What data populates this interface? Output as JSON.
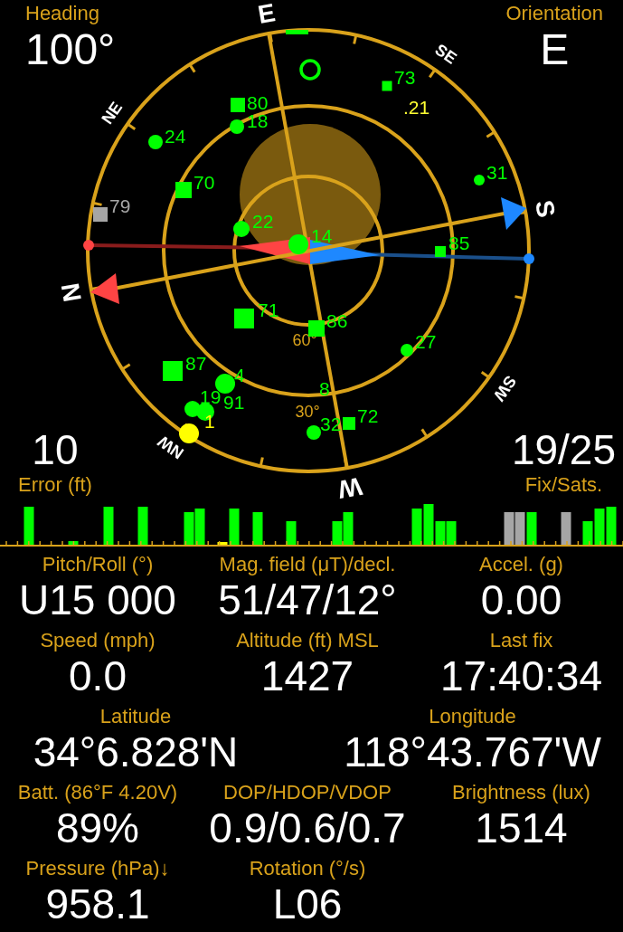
{
  "heading": {
    "label": "Heading",
    "value": "100°"
  },
  "orientation": {
    "label": "Orientation",
    "value": "E"
  },
  "compass_labels": [
    "N",
    "NE",
    "E",
    "SE",
    "S",
    "SW",
    "W",
    "NW"
  ],
  "elevation_labels": [
    "60°",
    "30°"
  ],
  "satellites": [
    {
      "label": "80",
      "kind": "square",
      "color": "#00ff00"
    },
    {
      "label": "18",
      "kind": "circle",
      "color": "#00ff00"
    },
    {
      "label": "24",
      "kind": "circle",
      "color": "#00ff00"
    },
    {
      "label": "70",
      "kind": "square",
      "color": "#00ff00"
    },
    {
      "label": "79",
      "kind": "square",
      "color": "#a6a6a6"
    },
    {
      "label": "22",
      "kind": "circle",
      "color": "#00ff00"
    },
    {
      "label": "14",
      "kind": "circle",
      "color": "#00ff00"
    },
    {
      "label": "73",
      "kind": "square",
      "color": "#00ff00"
    },
    {
      "label": ".21",
      "kind": "none",
      "color": "#ffff33"
    },
    {
      "label": "31",
      "kind": "circle",
      "color": "#00ff00"
    },
    {
      "label": "85",
      "kind": "square",
      "color": "#00ff00"
    },
    {
      "label": "71",
      "kind": "square",
      "color": "#00ff00"
    },
    {
      "label": "86",
      "kind": "square",
      "color": "#00ff00"
    },
    {
      "label": "27",
      "kind": "circle",
      "color": "#00ff00"
    },
    {
      "label": "87",
      "kind": "square",
      "color": "#00ff00"
    },
    {
      "label": "4",
      "kind": "circle",
      "color": "#00ff00"
    },
    {
      "label": "19",
      "kind": "circle",
      "color": "#00ff00"
    },
    {
      "label": "91",
      "kind": "circle",
      "color": "#00ff00"
    },
    {
      "label": "8",
      "kind": "none",
      "color": "#00ff00"
    },
    {
      "label": "32",
      "kind": "circle",
      "color": "#00ff00"
    },
    {
      "label": "72",
      "kind": "square",
      "color": "#00ff00"
    },
    {
      "label": "1",
      "kind": "circle",
      "color": "#ffff00"
    }
  ],
  "error": {
    "label": "Error (ft)",
    "value": "10"
  },
  "fix": {
    "label": "Fix/Sats.",
    "value": "19/25"
  },
  "readings": [
    [
      {
        "label": "Pitch/Roll (°)",
        "value": "U15 000"
      },
      {
        "label": "Mag. field (μT)/decl.",
        "value": "51/47/12°"
      },
      {
        "label": "Accel. (g)",
        "value": "0.00"
      }
    ],
    [
      {
        "label": "Speed (mph)",
        "value": "0.0"
      },
      {
        "label": "Altitude (ft) MSL",
        "value": "1427"
      },
      {
        "label": "Last fix",
        "value": "17:40:34"
      }
    ],
    [
      {
        "label": "Latitude",
        "value": "34°6.828'N"
      },
      {
        "label": "Longitude",
        "value": "118°43.767'W"
      }
    ],
    [
      {
        "label": "Batt. (86°F 4.20V)",
        "value": "89%"
      },
      {
        "label": "DOP/HDOP/VDOP",
        "value": "0.9/0.6/0.7"
      },
      {
        "label": "Brightness (lux)",
        "value": "1514"
      }
    ],
    [
      {
        "label": "Pressure (hPa)↓",
        "value": "958.1"
      },
      {
        "label": "Rotation (°/s)",
        "value": "L06"
      }
    ]
  ]
}
